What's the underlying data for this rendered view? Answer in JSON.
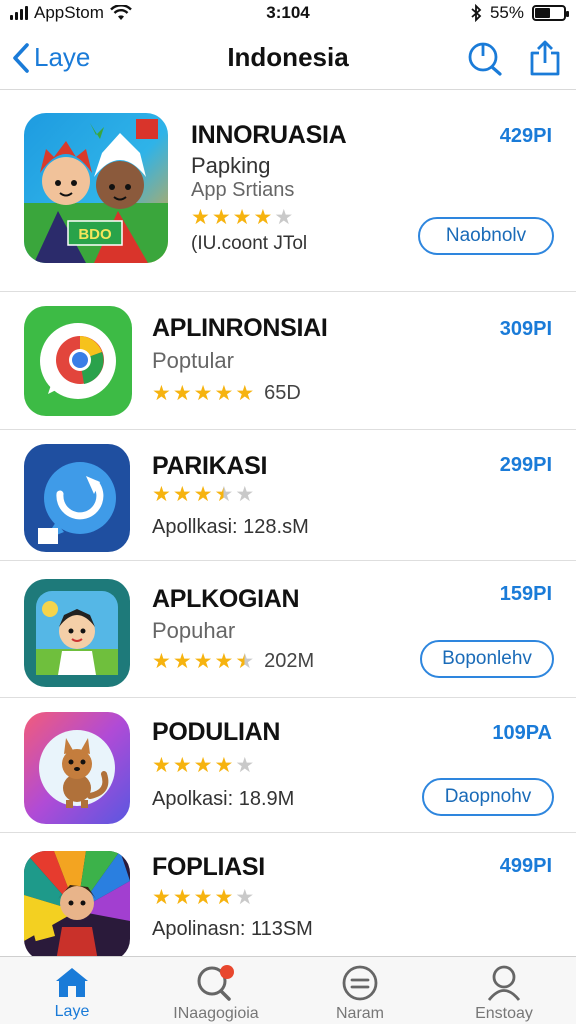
{
  "status_bar": {
    "carrier": "AppStom",
    "time": "3:104",
    "battery_percent": "55%",
    "battery_level": 0.55
  },
  "nav": {
    "back_label": "Laye",
    "title": "Indonesia"
  },
  "apps": [
    {
      "name": "INNORUASIA",
      "subtitle": "Papking",
      "category": "App Srtians",
      "rating": 4,
      "meta": "(IU.coont JTol",
      "price": "429PI",
      "button": "Naobnolv"
    },
    {
      "name": "APLINRONSIAI",
      "subtitle": "Poptular",
      "rating": 5,
      "meta": "65D",
      "price": "309PI"
    },
    {
      "name": "PARIKASI",
      "rating": 3.5,
      "meta": "Apollkasi: 128.sM",
      "price": "299PI"
    },
    {
      "name": "APLKOGIAN",
      "subtitle": "Popuhar",
      "rating": 4.5,
      "meta": "202M",
      "price": "159PI",
      "button": "Boponlehv"
    },
    {
      "name": "PODULIAN",
      "rating": 4,
      "meta": "Apolkasi: 18.9M",
      "price": "109PA",
      "button": "Daopnohv"
    },
    {
      "name": "FOPLIASI",
      "rating": 4,
      "meta": "Apolinasn: 113SM",
      "price": "499PI"
    }
  ],
  "icon_badge_text": "BDO",
  "tabs": [
    {
      "label": "Laye",
      "icon": "home-icon",
      "active": true
    },
    {
      "label": "INaagogioia",
      "icon": "search-icon",
      "active": false
    },
    {
      "label": "Naram",
      "icon": "list-icon",
      "active": false
    },
    {
      "label": "Enstoay",
      "icon": "person-icon",
      "active": false
    }
  ],
  "colors": {
    "accent": "#1a7bd8",
    "star": "#f6b30f"
  }
}
